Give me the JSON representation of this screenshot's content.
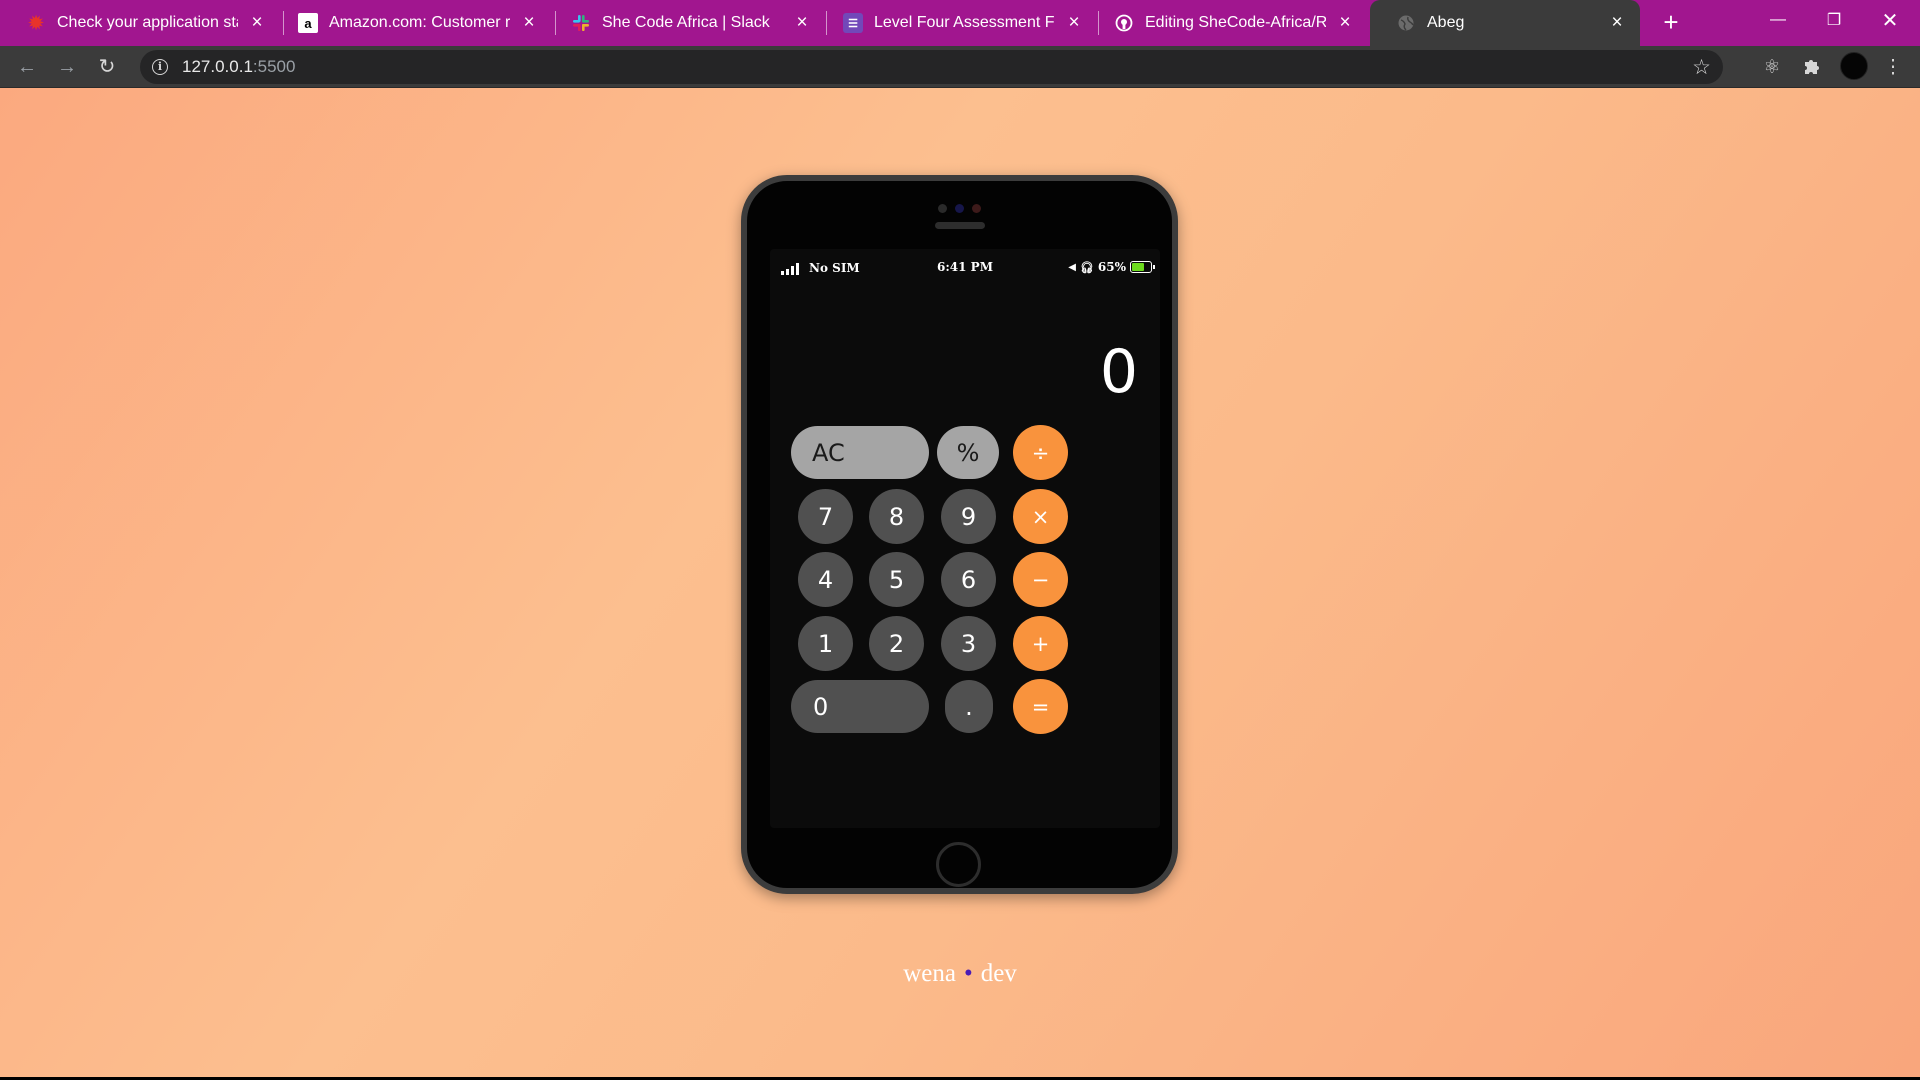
{
  "browser": {
    "tabs": [
      {
        "title": "Check your application status",
        "icon": "maple-leaf-icon"
      },
      {
        "title": "Amazon.com: Customer reviews",
        "icon": "amazon-icon"
      },
      {
        "title": "She Code Africa | Slack",
        "icon": "slack-icon"
      },
      {
        "title": "Level Four Assessment Form",
        "icon": "google-forms-icon"
      },
      {
        "title": "Editing SheCode-Africa/README",
        "icon": "github-icon"
      },
      {
        "title": "Abeg",
        "icon": "globe-icon"
      }
    ],
    "active_tab": 5,
    "url_host": "127.0.0.1",
    "url_port": ":5500"
  },
  "phone": {
    "status": {
      "carrier": "No SIM",
      "time": "6:41 PM",
      "battery": "65%",
      "battery_level": 0.65
    },
    "display": "0",
    "keys": [
      "AC",
      "%",
      "÷",
      "7",
      "8",
      "9",
      "×",
      "4",
      "5",
      "6",
      "−",
      "1",
      "2",
      "3",
      "+",
      "0",
      ".",
      "="
    ]
  },
  "footer": {
    "left": "wena",
    "separator": "•",
    "right": "dev"
  },
  "colors": {
    "tab_strip": "#a1168f",
    "operator": "#f9933d",
    "function_key": "#a5a5a5",
    "digit_key": "#505050"
  }
}
